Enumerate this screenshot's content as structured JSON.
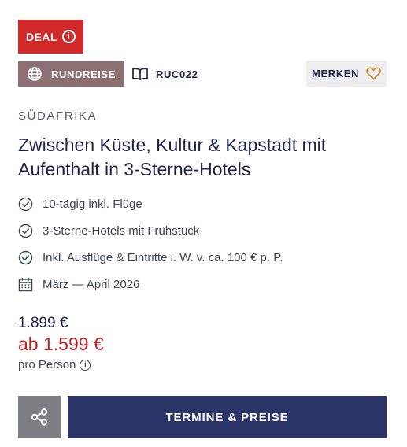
{
  "badges": {
    "deal_label": "DEAL",
    "deal_info_glyph": "i",
    "type_label": "RUNDREISE",
    "type_icon": "globe-icon",
    "code": "RUC022",
    "code_icon": "book-icon"
  },
  "merken": {
    "label": "MERKEN",
    "icon": "heart-icon"
  },
  "offer": {
    "country": "SÜDAFRIKA",
    "title": "Zwischen Küste, Kultur & Kapstadt mit Aufenthalt in 3-Sterne-Hotels"
  },
  "features": [
    {
      "icon": "check-circle-icon",
      "text": "10-tägig inkl. Flüge"
    },
    {
      "icon": "check-circle-icon",
      "text": "3-Sterne-Hotels mit Frühstück"
    },
    {
      "icon": "check-circle-icon",
      "text": "Inkl. Ausflüge & Eintritte i. W. v. ca. 100 € p. P."
    },
    {
      "icon": "calendar-icon",
      "text": "März — April 2026"
    }
  ],
  "price": {
    "old": "1.899 €",
    "new": "ab 1.599 €",
    "per_person": "pro Person",
    "info_glyph": "i"
  },
  "actions": {
    "share_icon": "share-icon",
    "cta_label": "TERMINE & PREISE"
  },
  "colors": {
    "deal_red": "#d02a2a",
    "type_badge": "#8b6f72",
    "navy": "#2b3466",
    "price_red": "#c42020",
    "share_grey": "#7d7e84",
    "heart_gold": "#c98a2b"
  }
}
